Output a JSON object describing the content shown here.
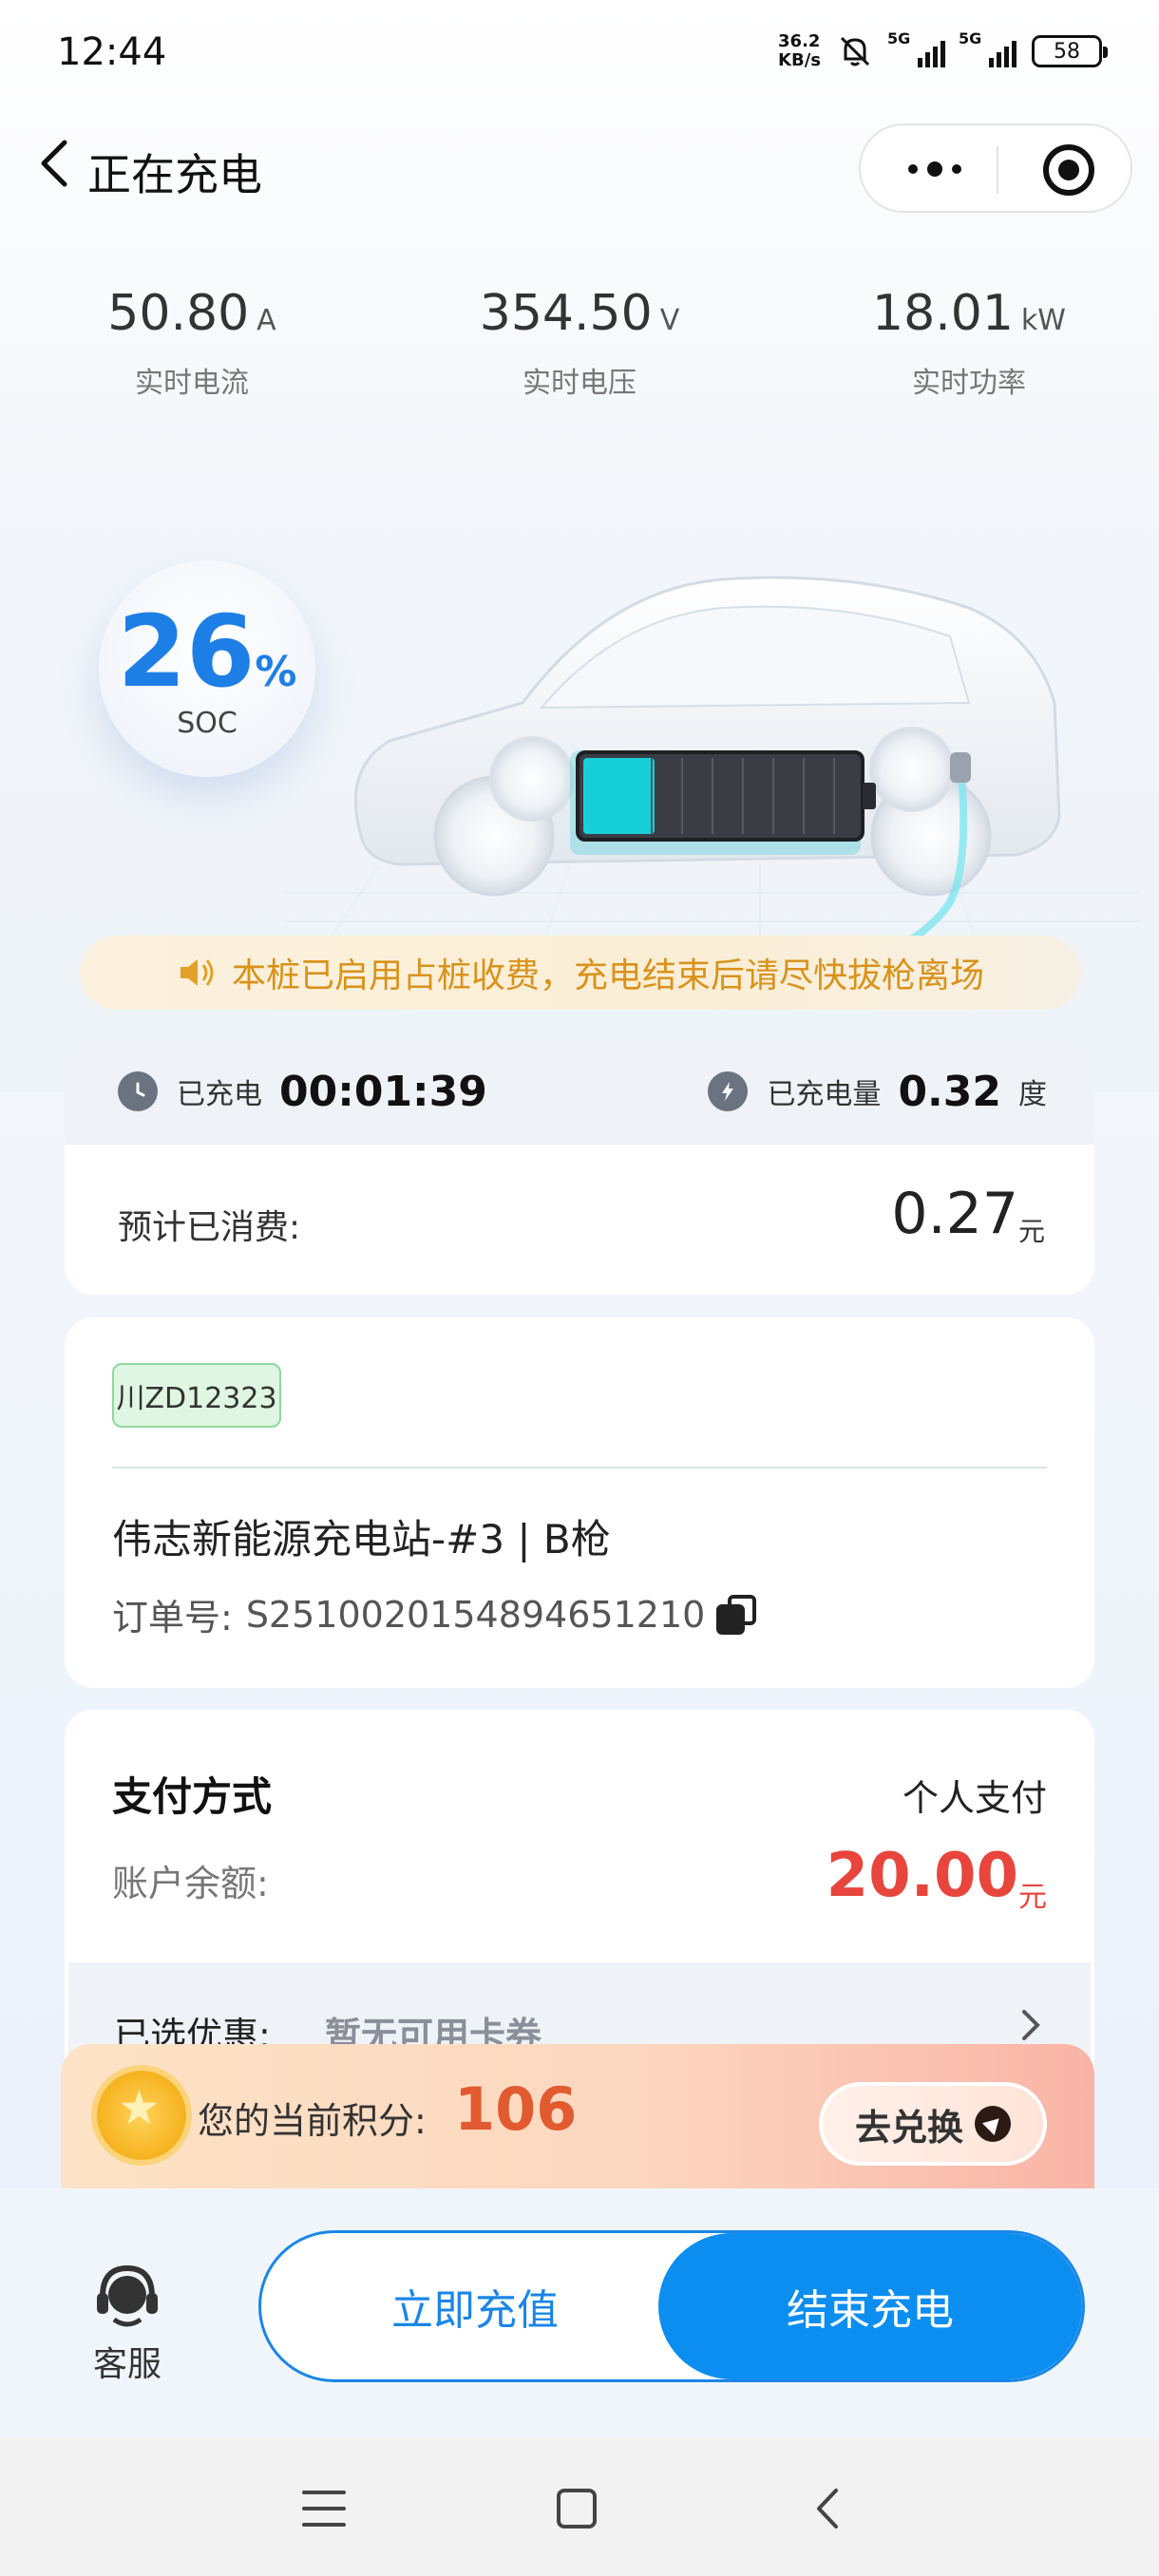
{
  "status_bar": {
    "time": "12:44",
    "net_speed_value": "36.2",
    "net_speed_unit": "KB/s",
    "signal1_tag": "5G",
    "signal2_tag": "5G",
    "battery": "58"
  },
  "nav": {
    "title": "正在充电"
  },
  "metrics": [
    {
      "value": "50.80",
      "unit": "A",
      "label": "实时电流"
    },
    {
      "value": "354.50",
      "unit": "V",
      "label": "实时电压"
    },
    {
      "value": "18.01",
      "unit": "kW",
      "label": "实时功率"
    }
  ],
  "soc": {
    "value": "26",
    "percent_sign": "%",
    "label": "SOC",
    "fill_fraction": 0.26
  },
  "notice": {
    "text": "本桩已启用占桩收费，充电结束后请尽快拔枪离场"
  },
  "charge_session": {
    "duration_label": "已充电",
    "duration_value": "00:01:39",
    "energy_label": "已充电量",
    "energy_value": "0.32",
    "energy_unit": "度",
    "cost_label": "预计已消费:",
    "cost_value": "0.27",
    "cost_unit": "元"
  },
  "order": {
    "plate": "川ZD12323",
    "station": "伟志新能源充电站-#3 | B枪",
    "order_label": "订单号:",
    "order_no": "S2510020154894651210"
  },
  "payment": {
    "title": "支付方式",
    "method": "个人支付",
    "balance_label": "账户余额:",
    "balance_value": "20.00",
    "balance_unit": "元",
    "discount_label": "已选优惠:",
    "discount_value": "暂无可用卡券"
  },
  "points": {
    "label": "您的当前积分:",
    "value": "106",
    "exchange_label": "去兑换"
  },
  "actions": {
    "service_label": "客服",
    "recharge_label": "立即充值",
    "end_label": "结束充电"
  },
  "colors": {
    "accent_blue": "#1a86e8",
    "soc_blue": "#1d7fe6",
    "battery_fill": "#17cfd6",
    "notice_text": "#d9921a",
    "balance_red": "#e8453c",
    "points_orange": "#e25a2f"
  }
}
